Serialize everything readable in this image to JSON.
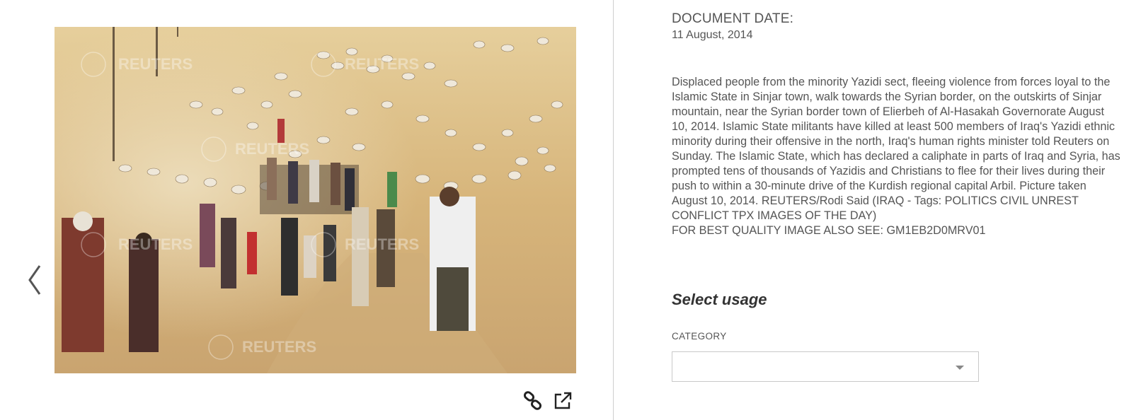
{
  "image_viewer": {
    "watermark": "REUTERS",
    "prev_icon": "chevron-left-icon",
    "link_icon": "link-icon",
    "open_icon": "external-link-icon"
  },
  "details": {
    "date_label": "DOCUMENT DATE:",
    "date_value": "11 August, 2014",
    "caption": "Displaced people from the minority Yazidi sect, fleeing violence from forces loyal to the Islamic State in Sinjar town, walk towards the Syrian border, on the outskirts of Sinjar mountain, near the Syrian border town of Elierbeh of Al-Hasakah Governorate August 10, 2014. Islamic State militants have killed at least 500 members of Iraq's Yazidi ethnic minority during their offensive in the north, Iraq's human rights minister told Reuters on Sunday. The Islamic State, which has declared a caliphate in parts of Iraq and Syria, has prompted tens of thousands of Yazidis and Christians to flee for their lives during their push to within a 30-minute drive of the Kurdish regional capital Arbil. Picture taken August 10, 2014. REUTERS/Rodi Said (IRAQ - Tags: POLITICS CIVIL UNREST CONFLICT TPX IMAGES OF THE DAY)\nFOR BEST QUALITY IMAGE ALSO SEE: GM1EB2D0MRV01"
  },
  "usage": {
    "title": "Select usage",
    "category_label": "CATEGORY",
    "category_value": ""
  },
  "colors": {
    "divider": "#cfcfcf",
    "text": "#555555",
    "heading": "#333333"
  }
}
